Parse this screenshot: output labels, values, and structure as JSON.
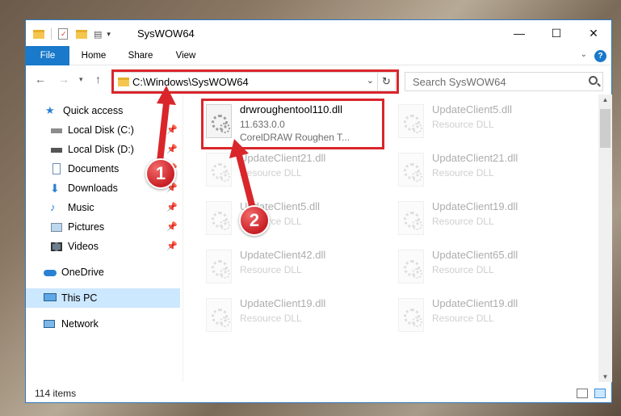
{
  "window": {
    "title": "SysWOW64"
  },
  "ribbon": {
    "tabs": [
      "File",
      "Home",
      "Share",
      "View"
    ]
  },
  "address": {
    "path": "C:\\Windows\\SysWOW64"
  },
  "search": {
    "placeholder": "Search SysWOW64"
  },
  "sidebar": {
    "items": [
      {
        "label": "Quick access",
        "icon": "star-icon",
        "pinned": false
      },
      {
        "label": "Local Disk (C:)",
        "icon": "drive-icon",
        "pinned": true
      },
      {
        "label": "Local Disk (D:)",
        "icon": "drive-icon",
        "pinned": true
      },
      {
        "label": "Documents",
        "icon": "document-icon",
        "pinned": true
      },
      {
        "label": "Downloads",
        "icon": "download-icon",
        "pinned": true
      },
      {
        "label": "Music",
        "icon": "music-icon",
        "pinned": true
      },
      {
        "label": "Pictures",
        "icon": "pictures-icon",
        "pinned": true
      },
      {
        "label": "Videos",
        "icon": "videos-icon",
        "pinned": true
      },
      {
        "label": "OneDrive",
        "icon": "cloud-icon",
        "pinned": false
      },
      {
        "label": "This PC",
        "icon": "computer-icon",
        "pinned": false,
        "selected": true
      },
      {
        "label": "Network",
        "icon": "network-icon",
        "pinned": false
      }
    ]
  },
  "files": [
    {
      "name": "drwroughentool110.dll",
      "line2": "11.633.0.0",
      "line3": "CorelDRAW Roughen T..."
    },
    {
      "name": "UpdateClient5.dll",
      "line2": "Resource DLL"
    },
    {
      "name": "UpdateClient21.dll",
      "line2": "Resource DLL"
    },
    {
      "name": "UpdateClient21.dll",
      "line2": "Resource DLL"
    },
    {
      "name": "UpdateClient5.dll",
      "line2": "Resource DLL"
    },
    {
      "name": "UpdateClient19.dll",
      "line2": "Resource DLL"
    },
    {
      "name": "UpdateClient42.dll",
      "line2": "Resource DLL"
    },
    {
      "name": "UpdateClient65.dll",
      "line2": "Resource DLL"
    },
    {
      "name": "UpdateClient19.dll",
      "line2": "Resource DLL"
    },
    {
      "name": "UpdateClient19.dll",
      "line2": "Resource DLL"
    }
  ],
  "status": {
    "count": "114 items"
  },
  "callouts": [
    "1",
    "2"
  ],
  "colors": {
    "accent": "#1979ca",
    "highlight": "#d9262b",
    "selected": "#cce8ff"
  }
}
